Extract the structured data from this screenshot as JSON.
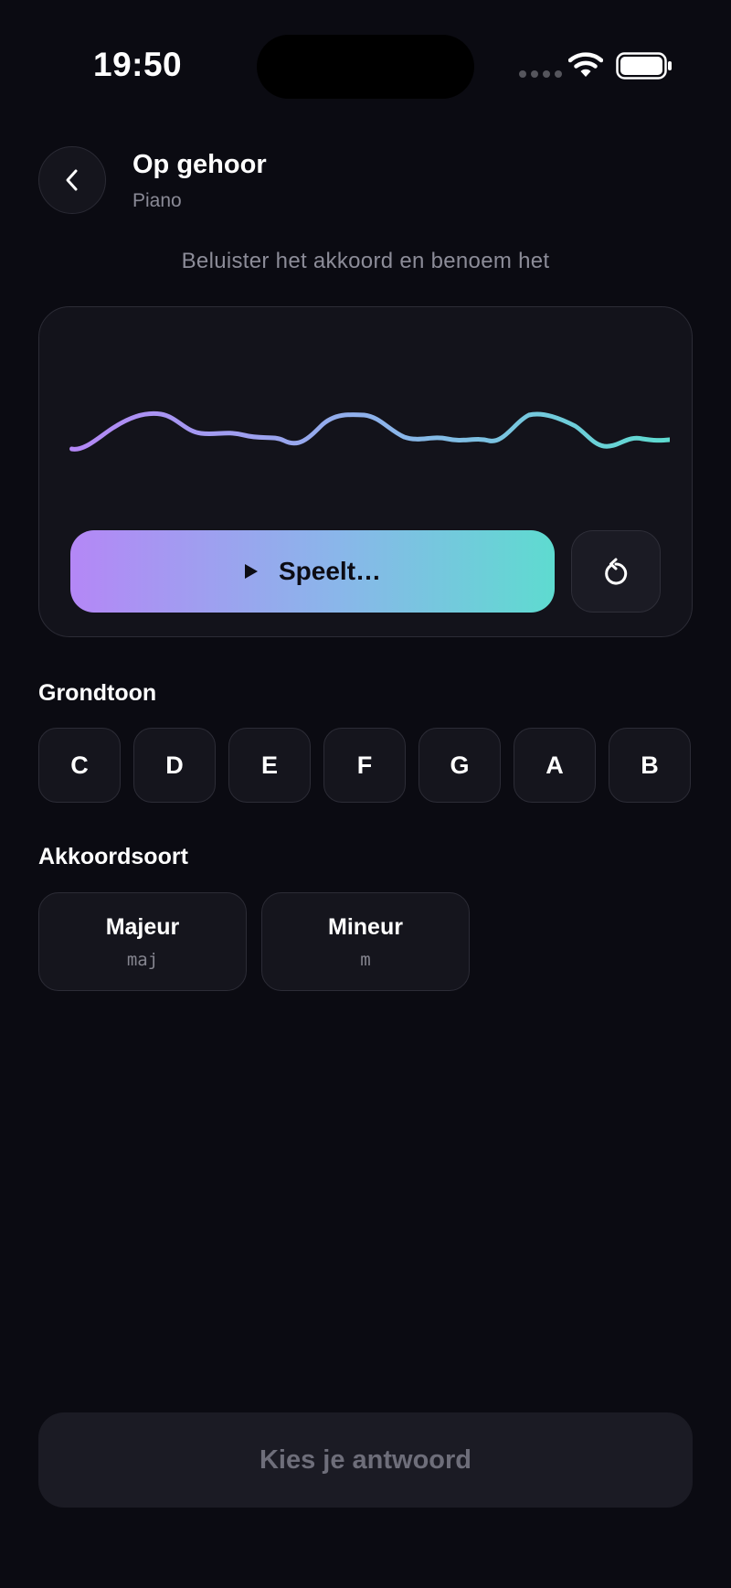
{
  "status_bar": {
    "time": "19:50"
  },
  "header": {
    "title": "Op gehoor",
    "subtitle": "Piano",
    "back_icon": "chevron-left-icon"
  },
  "instruction": "Beluister het akkoord en benoem het",
  "player": {
    "play_label": "Speelt…",
    "play_icon": "play-icon",
    "replay_icon": "replay-icon",
    "gradient_colors": [
      "#b487f6",
      "#8ab6ea",
      "#5edbd0"
    ]
  },
  "root_section": {
    "label": "Grondtoon",
    "notes": [
      "C",
      "D",
      "E",
      "F",
      "G",
      "A",
      "B"
    ]
  },
  "chord_section": {
    "label": "Akkoordsoort",
    "types": [
      {
        "name": "Majeur",
        "symbol": "maj"
      },
      {
        "name": "Mineur",
        "symbol": "m"
      }
    ]
  },
  "submit": {
    "label": "Kies je antwoord"
  },
  "colors": {
    "background": "#0b0b12",
    "card": "#13131b",
    "accent_start": "#b487f6",
    "accent_end": "#5edbd0"
  }
}
